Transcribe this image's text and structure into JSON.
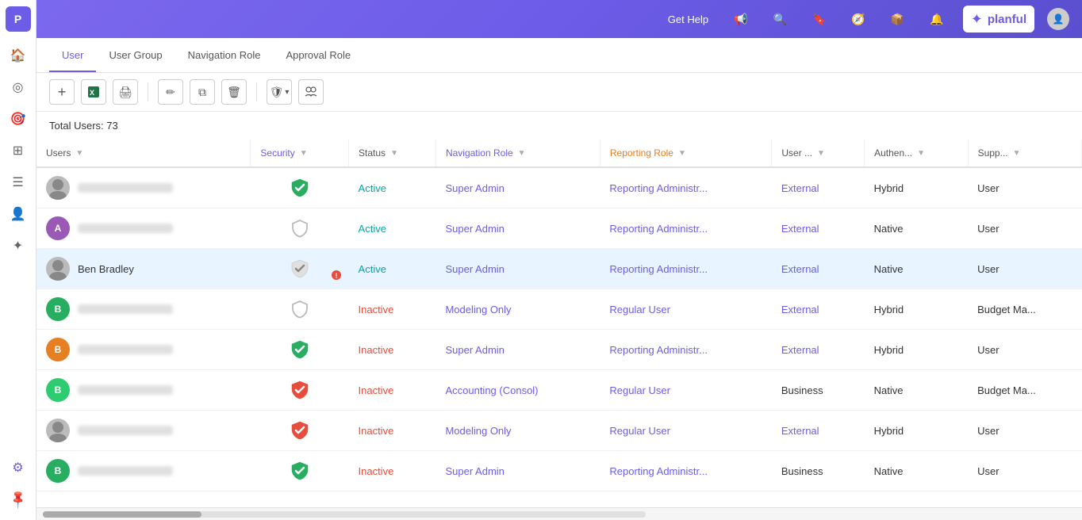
{
  "app": {
    "title": "Planful",
    "logo_letter": "P"
  },
  "header": {
    "get_help": "Get Help",
    "brand_name": "planful"
  },
  "sidebar": {
    "items": [
      {
        "icon": "🏠",
        "name": "home",
        "active": false
      },
      {
        "icon": "◎",
        "name": "circle",
        "active": false
      },
      {
        "icon": "⊙",
        "name": "target",
        "active": false
      },
      {
        "icon": "⊞",
        "name": "grid",
        "active": false
      },
      {
        "icon": "≡",
        "name": "list",
        "active": false
      },
      {
        "icon": "👤",
        "name": "user",
        "active": false
      },
      {
        "icon": "✦",
        "name": "star",
        "active": false
      },
      {
        "icon": "⚙",
        "name": "settings",
        "active": true
      }
    ]
  },
  "tabs": [
    {
      "label": "User",
      "active": true
    },
    {
      "label": "User Group",
      "active": false
    },
    {
      "label": "Navigation Role",
      "active": false
    },
    {
      "label": "Approval Role",
      "active": false
    }
  ],
  "toolbar": {
    "add": "+",
    "excel": "📊",
    "print": "🖨",
    "edit": "✏",
    "copy": "⧉",
    "delete": "🗑",
    "shield": "🛡",
    "users": "👥"
  },
  "total_users_label": "Total Users: 73",
  "table": {
    "columns": [
      {
        "label": "Users",
        "has_filter": true
      },
      {
        "label": "Security",
        "has_filter": true
      },
      {
        "label": "Status",
        "has_filter": true
      },
      {
        "label": "Navigation Role",
        "has_filter": true
      },
      {
        "label": "Reporting Role",
        "has_filter": true
      },
      {
        "label": "User ...",
        "has_filter": true
      },
      {
        "label": "Authen...",
        "has_filter": true
      },
      {
        "label": "Supp...",
        "has_filter": true
      }
    ],
    "rows": [
      {
        "avatar_bg": "#7b7b7b",
        "avatar_type": "photo",
        "avatar_letter": "",
        "name_blurred": true,
        "name": "",
        "security": "shield-check-green",
        "status": "Active",
        "status_type": "active",
        "nav_role": "Super Admin",
        "reporting_role": "Reporting Administr...",
        "user_type": "External",
        "user_type_class": "external",
        "auth": "Hybrid",
        "support": "User",
        "highlighted": false
      },
      {
        "avatar_bg": "#9b59b6",
        "avatar_type": "letter",
        "avatar_letter": "A",
        "name_blurred": true,
        "name": "",
        "security": "shield-outline",
        "status": "Active",
        "status_type": "active",
        "nav_role": "Super Admin",
        "reporting_role": "Reporting Administr...",
        "user_type": "External",
        "user_type_class": "external",
        "auth": "Native",
        "support": "User",
        "highlighted": false
      },
      {
        "avatar_bg": "#7b7b7b",
        "avatar_type": "photo",
        "avatar_letter": "",
        "name_blurred": false,
        "name": "Ben Bradley",
        "security": "shield-check-pending",
        "status": "Active",
        "status_type": "active",
        "nav_role": "Super Admin",
        "reporting_role": "Reporting Administr...",
        "user_type": "External",
        "user_type_class": "external",
        "auth": "Native",
        "support": "User",
        "highlighted": true
      },
      {
        "avatar_bg": "#27ae60",
        "avatar_type": "letter",
        "avatar_letter": "B",
        "name_blurred": true,
        "name": "",
        "security": "shield-outline",
        "status": "Inactive",
        "status_type": "inactive",
        "nav_role": "Modeling Only",
        "reporting_role": "Regular User",
        "user_type": "External",
        "user_type_class": "external",
        "auth": "Hybrid",
        "support": "Budget Ma...",
        "highlighted": false
      },
      {
        "avatar_bg": "#e67e22",
        "avatar_type": "letter",
        "avatar_letter": "B",
        "name_blurred": true,
        "name": "",
        "security": "shield-check-green",
        "status": "Inactive",
        "status_type": "inactive",
        "nav_role": "Super Admin",
        "reporting_role": "Reporting Administr...",
        "user_type": "External",
        "user_type_class": "external",
        "auth": "Hybrid",
        "support": "User",
        "highlighted": false
      },
      {
        "avatar_bg": "#2ecc71",
        "avatar_type": "letter",
        "avatar_letter": "B",
        "name_blurred": true,
        "name": "",
        "security": "shield-check-red",
        "status": "Inactive",
        "status_type": "inactive",
        "nav_role": "Accounting (Consol)",
        "reporting_role": "Regular User",
        "user_type": "Business",
        "user_type_class": "business",
        "auth": "Native",
        "support": "Budget Ma...",
        "highlighted": false
      },
      {
        "avatar_bg": "#7b7b7b",
        "avatar_type": "photo",
        "avatar_letter": "",
        "name_blurred": true,
        "name": "",
        "security": "shield-check-red",
        "status": "Inactive",
        "status_type": "inactive",
        "nav_role": "Modeling Only",
        "reporting_role": "Regular User",
        "user_type": "External",
        "user_type_class": "external",
        "auth": "Hybrid",
        "support": "User",
        "highlighted": false
      },
      {
        "avatar_bg": "#27ae60",
        "avatar_type": "letter",
        "avatar_letter": "B",
        "name_blurred": true,
        "name": "",
        "security": "shield-check-green",
        "status": "Inactive",
        "status_type": "inactive",
        "nav_role": "Super Admin",
        "reporting_role": "Reporting Administr...",
        "user_type": "Business",
        "user_type_class": "business",
        "auth": "Native",
        "support": "User",
        "highlighted": false
      }
    ]
  }
}
